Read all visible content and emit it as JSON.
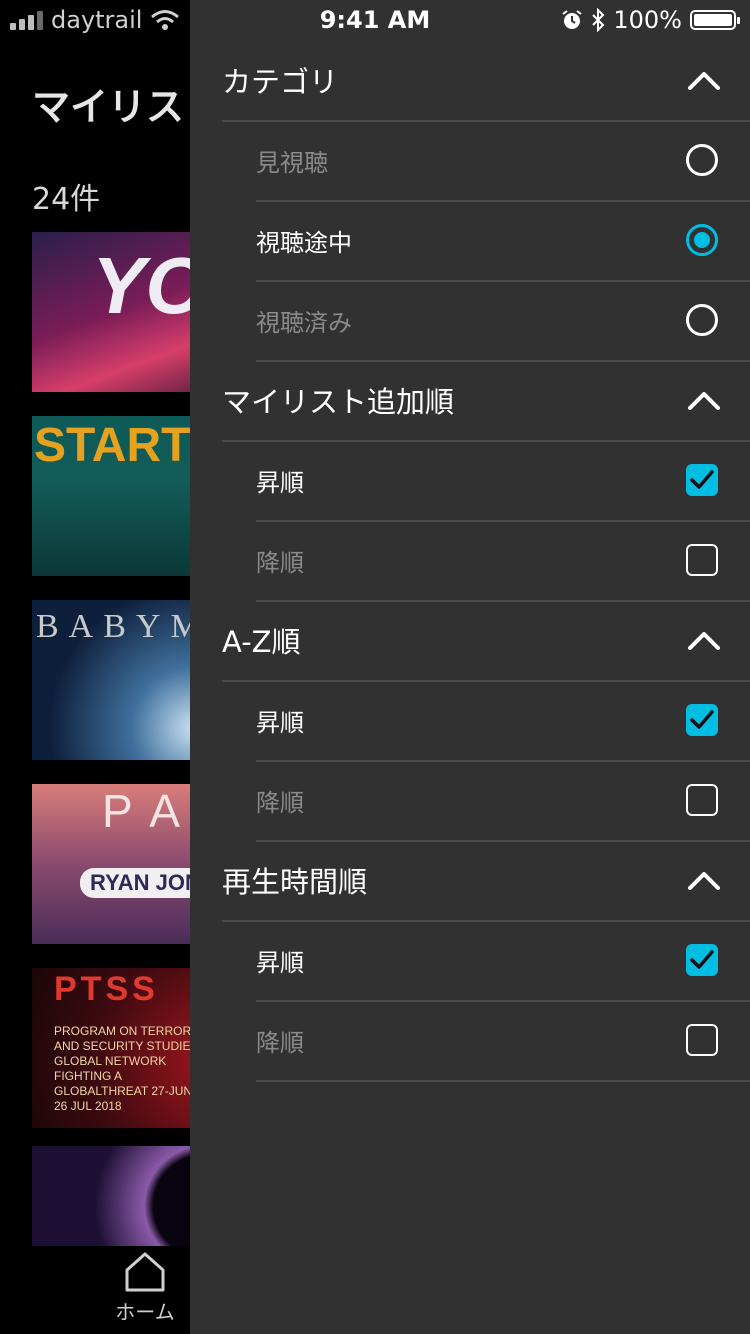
{
  "status_bar": {
    "carrier": "daytrail",
    "time": "9:41 AM",
    "battery": "100%"
  },
  "background": {
    "title": "マイリス",
    "count": "24件",
    "thumbnails": {
      "t1": "YOU",
      "t2": "START",
      "t3": "BABYM",
      "t4": "PAI",
      "t4b": "RYAN JON",
      "t5": "PTSS",
      "t5b": "PROGRAM ON TERRORISM AND SECURITY STUDIES A GLOBAL NETWORK FIGHTING A GLOBALTHREAT 27-JUN - 26 JUL 2018"
    },
    "tab_home_label": "ホーム"
  },
  "drawer": {
    "category": {
      "title": "カテゴリ",
      "options": [
        {
          "label": "見視聴",
          "selected": false
        },
        {
          "label": "視聴途中",
          "selected": true
        },
        {
          "label": "視聴済み",
          "selected": false
        }
      ]
    },
    "mylist_order": {
      "title": "マイリスト追加順",
      "options": [
        {
          "label": "昇順",
          "checked": true
        },
        {
          "label": "降順",
          "checked": false
        }
      ]
    },
    "az_order": {
      "title": "A-Z順",
      "options": [
        {
          "label": "昇順",
          "checked": true
        },
        {
          "label": "降順",
          "checked": false
        }
      ]
    },
    "playtime_order": {
      "title": "再生時間順",
      "options": [
        {
          "label": "昇順",
          "checked": true
        },
        {
          "label": "降順",
          "checked": false
        }
      ]
    }
  },
  "colors": {
    "accent": "#00bde3",
    "drawer_bg": "#313131",
    "divider": "#4a4a4a"
  }
}
